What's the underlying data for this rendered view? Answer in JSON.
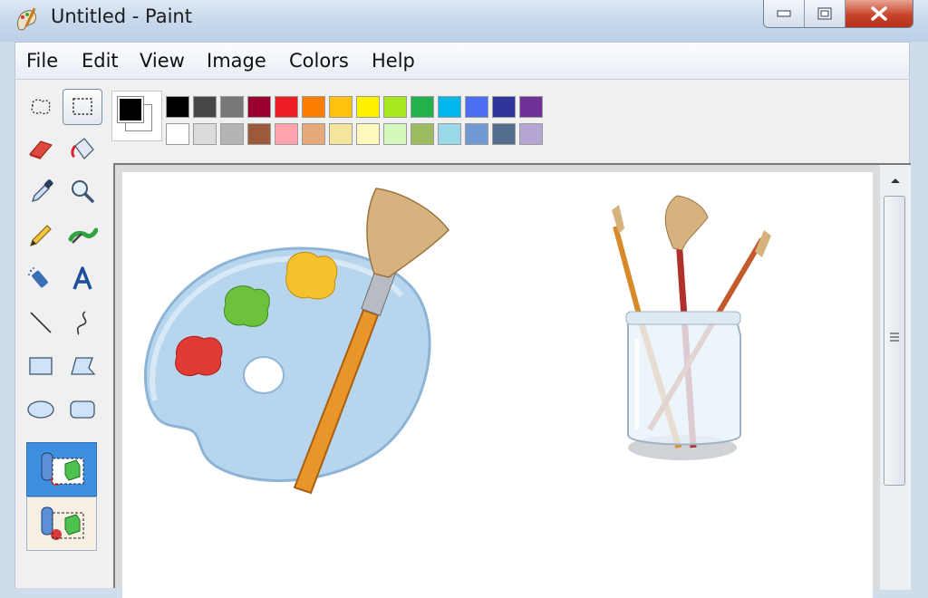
{
  "window": {
    "title": "Untitled - Paint",
    "app_icon": "paint-brush-icon",
    "controls": {
      "minimize": "minimize-icon",
      "maximize": "maximize-icon",
      "close": "close-icon"
    }
  },
  "menu": {
    "items": [
      {
        "label": "File"
      },
      {
        "label": "Edit"
      },
      {
        "label": "View"
      },
      {
        "label": "Image"
      },
      {
        "label": "Colors"
      },
      {
        "label": "Help"
      }
    ]
  },
  "tools": [
    {
      "name": "free-form-select",
      "icon": "lasso-icon",
      "selected": false
    },
    {
      "name": "select",
      "icon": "rectangle-select-icon",
      "selected": true
    },
    {
      "name": "eraser",
      "icon": "eraser-icon",
      "selected": false
    },
    {
      "name": "fill-with-color",
      "icon": "paint-bucket-icon",
      "selected": false
    },
    {
      "name": "pick-color",
      "icon": "eyedropper-icon",
      "selected": false
    },
    {
      "name": "magnifier",
      "icon": "magnifier-icon",
      "selected": false
    },
    {
      "name": "pencil",
      "icon": "pencil-icon",
      "selected": false
    },
    {
      "name": "brush",
      "icon": "brush-icon",
      "selected": false
    },
    {
      "name": "airbrush",
      "icon": "airbrush-icon",
      "selected": false
    },
    {
      "name": "text",
      "icon": "text-icon",
      "selected": false
    },
    {
      "name": "line",
      "icon": "line-icon",
      "selected": false
    },
    {
      "name": "curve",
      "icon": "curve-icon",
      "selected": false
    },
    {
      "name": "rectangle",
      "icon": "rectangle-icon",
      "selected": false
    },
    {
      "name": "polygon",
      "icon": "polygon-icon",
      "selected": false
    },
    {
      "name": "ellipse",
      "icon": "ellipse-icon",
      "selected": false
    },
    {
      "name": "rounded-rectangle",
      "icon": "rounded-rectangle-icon",
      "selected": false
    }
  ],
  "selection_options": [
    {
      "name": "opaque-selection",
      "icon": "opaque-selection-icon",
      "active": true
    },
    {
      "name": "transparent-selection",
      "icon": "transparent-selection-icon",
      "active": false
    }
  ],
  "colors": {
    "primary": "#000000",
    "secondary": "#ffffff",
    "palette_row1": [
      "#000000",
      "#464646",
      "#787878",
      "#990030",
      "#ed1c24",
      "#ff7e00",
      "#ffc20e",
      "#fff200",
      "#a8e61d",
      "#22b14c",
      "#00b7ef",
      "#4d6df3",
      "#2f3699",
      "#6f3198"
    ],
    "palette_row2": [
      "#ffffff",
      "#dcdcdc",
      "#b4b4b4",
      "#9c5a3c",
      "#ffa3b1",
      "#e5aa7a",
      "#f5e49c",
      "#fff9bd",
      "#d3f9bc",
      "#9dbb61",
      "#99d9ea",
      "#709ad1",
      "#546d8e",
      "#b5a5d5"
    ]
  },
  "canvas": {
    "images": [
      "palette-with-brush-illustration",
      "brushes-in-jar-illustration"
    ]
  }
}
